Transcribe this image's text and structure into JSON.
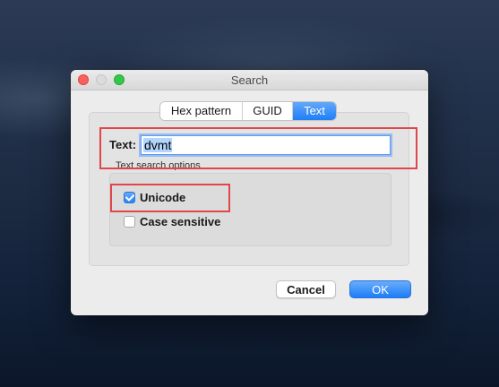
{
  "window": {
    "title": "Search"
  },
  "tabs": [
    {
      "label": "Hex pattern",
      "active": false
    },
    {
      "label": "GUID",
      "active": false
    },
    {
      "label": "Text",
      "active": true
    }
  ],
  "text_field": {
    "label": "Text:",
    "value": "dvmt"
  },
  "options": {
    "group_label": "Text search options",
    "unicode": {
      "label": "Unicode",
      "checked": true
    },
    "case_sensitive": {
      "label": "Case sensitive",
      "checked": false
    }
  },
  "buttons": {
    "cancel": "Cancel",
    "ok": "OK"
  },
  "colors": {
    "accent": "#1f7ef7",
    "annotation": "#e0464a"
  }
}
